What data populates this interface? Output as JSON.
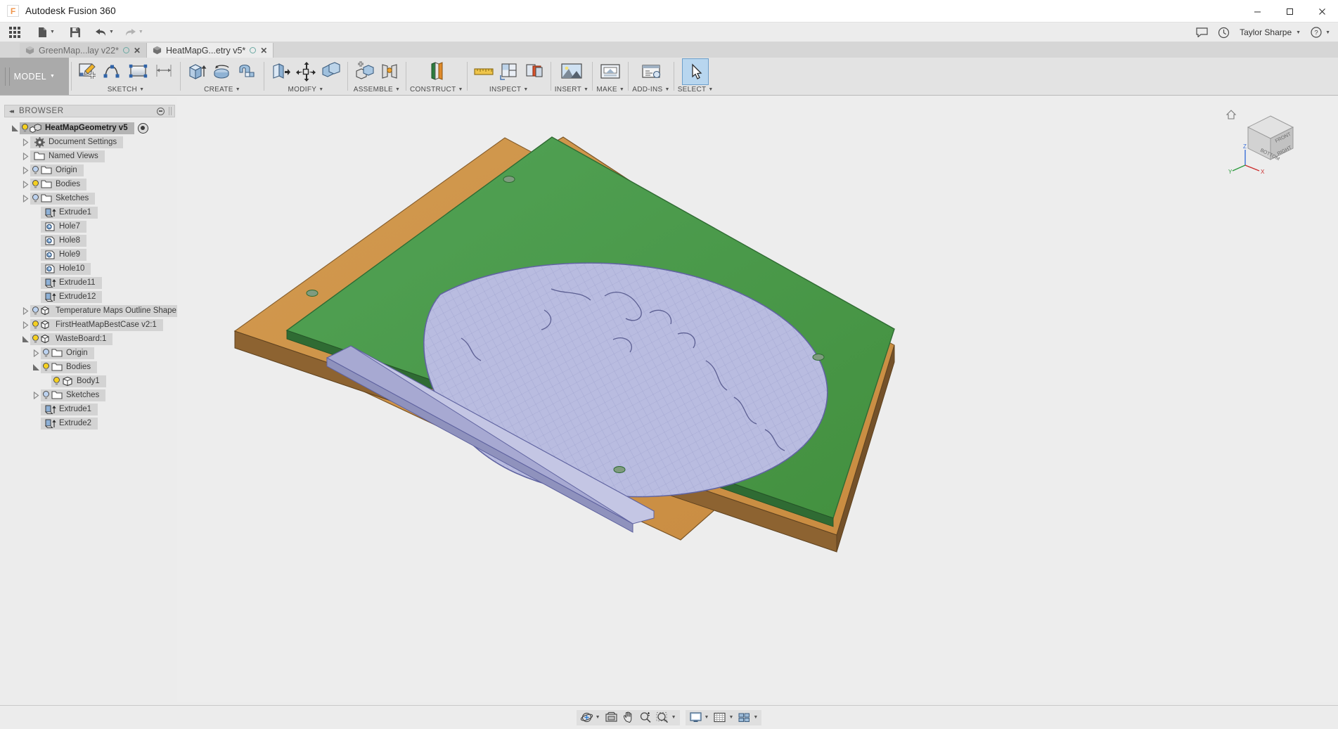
{
  "window": {
    "title": "Autodesk Fusion 360",
    "logo_letter": "F",
    "minimize": "─",
    "maximize": "☐",
    "close": "✕"
  },
  "quick_access": {
    "app_grid": "app-grid",
    "new_file": "new-file",
    "save": "save",
    "undo": "undo",
    "redo": "redo",
    "right_items": [
      {
        "name": "comments-icon",
        "glyph": "💬"
      },
      {
        "name": "job-status-icon",
        "glyph": "◴"
      }
    ],
    "user_name": "Taylor Sharpe",
    "help_label": "?"
  },
  "doc_tabs": [
    {
      "label": "GreenMap...lay v22*",
      "active": false,
      "modified": true
    },
    {
      "label": "HeatMapG...etry v5*",
      "active": true,
      "modified": true
    }
  ],
  "ribbon": {
    "mode": "MODEL",
    "groups": [
      {
        "label": "SKETCH",
        "has_caret": true,
        "tools": [
          {
            "name": "create-sketch-icon"
          },
          {
            "name": "spline-icon"
          },
          {
            "name": "rectangle-icon"
          },
          {
            "name": "sketch-dimension-icon"
          }
        ]
      },
      {
        "label": "CREATE",
        "has_caret": true,
        "tools": [
          {
            "name": "extrude-icon"
          },
          {
            "name": "revolve-icon"
          },
          {
            "name": "sweep-icon"
          }
        ]
      },
      {
        "label": "MODIFY",
        "has_caret": true,
        "tools": [
          {
            "name": "press-pull-icon"
          },
          {
            "name": "move-copy-icon"
          },
          {
            "name": "combine-icon"
          }
        ]
      },
      {
        "label": "ASSEMBLE",
        "has_caret": true,
        "tools": [
          {
            "name": "new-component-icon"
          },
          {
            "name": "joint-icon"
          }
        ]
      },
      {
        "label": "CONSTRUCT",
        "has_caret": true,
        "tools": [
          {
            "name": "offset-plane-icon"
          }
        ]
      },
      {
        "label": "INSPECT",
        "has_caret": true,
        "tools": [
          {
            "name": "measure-icon"
          },
          {
            "name": "section-analysis-icon"
          },
          {
            "name": "interference-icon"
          }
        ]
      },
      {
        "label": "INSERT",
        "has_caret": true,
        "tools": [
          {
            "name": "insert-mesh-icon"
          }
        ]
      },
      {
        "label": "MAKE",
        "has_caret": true,
        "tools": [
          {
            "name": "3d-print-icon"
          }
        ]
      },
      {
        "label": "ADD-INS",
        "has_caret": true,
        "tools": [
          {
            "name": "scripts-addins-icon"
          }
        ]
      },
      {
        "label": "SELECT",
        "has_caret": true,
        "tools": [
          {
            "name": "select-tool-icon",
            "selected": true
          }
        ]
      }
    ]
  },
  "browser": {
    "header": "BROWSER",
    "collapse": "◂◂",
    "tree": [
      {
        "label": "HeatMapGeometry v5",
        "indent": 0,
        "toggle": "open",
        "bulb": "on",
        "icon": "component-icon",
        "root": true,
        "eye": true
      },
      {
        "label": "Document Settings",
        "indent": 1,
        "toggle": "closed",
        "bulb": "none",
        "icon": "gear-icon"
      },
      {
        "label": "Named Views",
        "indent": 1,
        "toggle": "closed",
        "bulb": "none",
        "icon": "folder-icon"
      },
      {
        "label": "Origin",
        "indent": 1,
        "toggle": "closed",
        "bulb": "off",
        "icon": "folder-icon"
      },
      {
        "label": "Bodies",
        "indent": 1,
        "toggle": "closed",
        "bulb": "on",
        "icon": "folder-icon"
      },
      {
        "label": "Sketches",
        "indent": 1,
        "toggle": "closed",
        "bulb": "off",
        "icon": "folder-icon"
      },
      {
        "label": "Extrude1",
        "indent": 2,
        "toggle": "none",
        "bulb": "none",
        "icon": "extrude-feature-icon"
      },
      {
        "label": "Hole7",
        "indent": 2,
        "toggle": "none",
        "bulb": "none",
        "icon": "hole-feature-icon"
      },
      {
        "label": "Hole8",
        "indent": 2,
        "toggle": "none",
        "bulb": "none",
        "icon": "hole-feature-icon"
      },
      {
        "label": "Hole9",
        "indent": 2,
        "toggle": "none",
        "bulb": "none",
        "icon": "hole-feature-icon"
      },
      {
        "label": "Hole10",
        "indent": 2,
        "toggle": "none",
        "bulb": "none",
        "icon": "hole-feature-icon"
      },
      {
        "label": "Extrude11",
        "indent": 2,
        "toggle": "none",
        "bulb": "none",
        "icon": "extrude-feature-icon"
      },
      {
        "label": "Extrude12",
        "indent": 2,
        "toggle": "none",
        "bulb": "none",
        "icon": "extrude-feature-icon"
      },
      {
        "label": "Temperature Maps Outline Shape v...",
        "indent": 1,
        "toggle": "closed",
        "bulb": "off",
        "icon": "component-icon"
      },
      {
        "label": "FirstHeatMapBestCase v2:1",
        "indent": 1,
        "toggle": "closed",
        "bulb": "on",
        "icon": "component-icon"
      },
      {
        "label": "WasteBoard:1",
        "indent": 1,
        "toggle": "open",
        "bulb": "on",
        "icon": "component-icon"
      },
      {
        "label": "Origin",
        "indent": 2,
        "toggle": "closed",
        "bulb": "off",
        "icon": "folder-icon"
      },
      {
        "label": "Bodies",
        "indent": 2,
        "toggle": "open",
        "bulb": "on",
        "icon": "folder-icon"
      },
      {
        "label": "Body1",
        "indent": 3,
        "toggle": "none",
        "bulb": "on",
        "icon": "body-icon"
      },
      {
        "label": "Sketches",
        "indent": 2,
        "toggle": "closed",
        "bulb": "off",
        "icon": "folder-icon"
      },
      {
        "label": "Extrude1",
        "indent": 2,
        "toggle": "none",
        "bulb": "none",
        "icon": "extrude-feature-icon"
      },
      {
        "label": "Extrude2",
        "indent": 2,
        "toggle": "none",
        "bulb": "none",
        "icon": "extrude-feature-icon"
      }
    ]
  },
  "viewcube": {
    "front_label": "FRONT",
    "right_label": "RIGHT",
    "bottom_label": "BOTTOM",
    "axis_z": "Z",
    "axis_x": "X",
    "axis_y": "Y"
  },
  "canvas": {
    "colors": {
      "wasteboard_top": "#cf9348",
      "wasteboard_side": "#8d6331",
      "wasteboard_front": "#b07c3c",
      "green_plate": "#4c9b4f",
      "green_edge": "#2f6b33",
      "heatmap_fill": "#b9bce0",
      "heatmap_line": "#7b7fb0",
      "background": "#ededed"
    },
    "bodies": [
      "WasteBoard",
      "Green Outline Plate",
      "Heat Map Surface",
      "Rail Extrusion"
    ]
  },
  "navbar": {
    "groups": [
      {
        "buttons": [
          {
            "name": "orbit-icon",
            "has_caret": true
          },
          {
            "name": "look-at-icon",
            "has_caret": false
          },
          {
            "name": "pan-icon",
            "has_caret": false
          },
          {
            "name": "zoom-icon",
            "has_caret": false
          },
          {
            "name": "zoom-window-icon",
            "has_caret": true
          }
        ]
      },
      {
        "buttons": [
          {
            "name": "display-settings-icon",
            "has_caret": true
          },
          {
            "name": "grid-snaps-icon",
            "has_caret": true
          },
          {
            "name": "viewports-icon",
            "has_caret": true
          }
        ]
      }
    ]
  }
}
